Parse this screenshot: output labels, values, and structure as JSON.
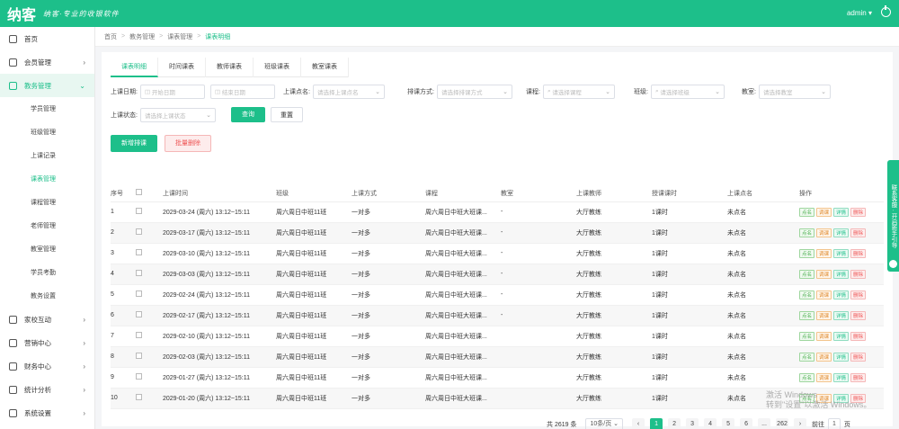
{
  "header": {
    "logo": "纳客",
    "slogan": "纳客·专业的收银软件",
    "user": "admin"
  },
  "sidebar": {
    "items": [
      {
        "label": "首页",
        "icon": "home-icon",
        "expandable": false
      },
      {
        "label": "会员管理",
        "icon": "member-icon",
        "expandable": true
      },
      {
        "label": "教务管理",
        "icon": "teaching-icon",
        "expandable": true,
        "active": true
      }
    ],
    "sub_items": [
      {
        "label": "学员管理"
      },
      {
        "label": "班级管理"
      },
      {
        "label": "上课记录"
      },
      {
        "label": "课表管理",
        "active": true
      },
      {
        "label": "课程管理"
      },
      {
        "label": "老师管理"
      },
      {
        "label": "教室管理"
      },
      {
        "label": "学员考勤"
      },
      {
        "label": "教务设置"
      }
    ],
    "items_bottom": [
      {
        "label": "家校互动",
        "icon": "interaction-icon"
      },
      {
        "label": "营销中心",
        "icon": "marketing-icon"
      },
      {
        "label": "财务中心",
        "icon": "finance-icon"
      },
      {
        "label": "统计分析",
        "icon": "stats-icon"
      },
      {
        "label": "系统设置",
        "icon": "settings-icon"
      }
    ]
  },
  "breadcrumb": [
    "首页",
    "教务管理",
    "课表管理",
    "课表明细"
  ],
  "tabs": [
    {
      "label": "课表明细",
      "active": true
    },
    {
      "label": "时间课表"
    },
    {
      "label": "教师课表"
    },
    {
      "label": "班级课表"
    },
    {
      "label": "教室课表"
    }
  ],
  "filters": {
    "date_label": "上课日期:",
    "date_start_placeholder": "开始日期",
    "date_end_placeholder": "结束日期",
    "sign_label": "上课点名:",
    "sign_placeholder": "请选择上课点名",
    "mode_label": "排课方式:",
    "mode_placeholder": "请选择排课方式",
    "course_label": "课程:",
    "course_placeholder": "请选择课程",
    "class_label": "班级:",
    "class_placeholder": "请选择班级",
    "teacher_label": "教室:",
    "teacher_placeholder": "请选择教室",
    "status_label": "上课状态:",
    "status_placeholder": "请选择上课状态",
    "search_btn": "查询",
    "reset_btn": "重置"
  },
  "actions": {
    "add_btn": "新增排课",
    "batch_delete_btn": "批量删除"
  },
  "table": {
    "headers": [
      "序号",
      "",
      "上课时间",
      "班级",
      "上课方式",
      "课程",
      "教室",
      "上课教师",
      "授课课时",
      "上课点名",
      "操作"
    ],
    "rows": [
      [
        "1",
        "",
        "2029-03-24 (周六) 13:12~15:11",
        "周六周日中班11班",
        "一对多",
        "周六周日中班大班课...",
        "-",
        "大厅教练",
        "1课时",
        "未点名"
      ],
      [
        "2",
        "",
        "2029-03-17 (周六) 13:12~15:11",
        "周六周日中班11班",
        "一对多",
        "周六周日中班大班课...",
        "-",
        "大厅教练",
        "1课时",
        "未点名"
      ],
      [
        "3",
        "",
        "2029-03-10 (周六) 13:12~15:11",
        "周六周日中班11班",
        "一对多",
        "周六周日中班大班课...",
        "-",
        "大厅教练",
        "1课时",
        "未点名"
      ],
      [
        "4",
        "",
        "2029-03-03 (周六) 13:12~15:11",
        "周六周日中班11班",
        "一对多",
        "周六周日中班大班课...",
        "-",
        "大厅教练",
        "1课时",
        "未点名"
      ],
      [
        "5",
        "",
        "2029-02-24 (周六) 13:12~15:11",
        "周六周日中班11班",
        "一对多",
        "周六周日中班大班课...",
        "-",
        "大厅教练",
        "1课时",
        "未点名"
      ],
      [
        "6",
        "",
        "2029-02-17 (周六) 13:12~15:11",
        "周六周日中班11班",
        "一对多",
        "周六周日中班大班课...",
        "-",
        "大厅教练",
        "1课时",
        "未点名"
      ],
      [
        "7",
        "",
        "2029-02-10 (周六) 13:12~15:11",
        "周六周日中班11班",
        "一对多",
        "周六周日中班大班课...",
        "",
        "大厅教练",
        "1课时",
        "未点名"
      ],
      [
        "8",
        "",
        "2029-02-03 (周六) 13:12~15:11",
        "周六周日中班11班",
        "一对多",
        "周六周日中班大班课...",
        "",
        "大厅教练",
        "1课时",
        "未点名"
      ],
      [
        "9",
        "",
        "2029-01-27 (周六) 13:12~15:11",
        "周六周日中班11班",
        "一对多",
        "周六周日中班大班课...",
        "",
        "大厅教练",
        "1课时",
        "未点名"
      ],
      [
        "10",
        "",
        "2029-01-20 (周六) 13:12~15:11",
        "周六周日中班11班",
        "一对多",
        "周六周日中班大班课...",
        "",
        "大厅教练",
        "1课时",
        "未点名"
      ]
    ],
    "ops": [
      "点名",
      "调课",
      "详情",
      "删除"
    ]
  },
  "pagination": {
    "total": "共 2619 条",
    "page_size": "10条/页",
    "pages": [
      "1",
      "2",
      "3",
      "4",
      "5",
      "6",
      "...",
      "262"
    ],
    "goto_label": "前往",
    "goto_value": "1",
    "page_unit": "页"
  },
  "float_bar": {
    "label": "联系客服 · 开启新手引导"
  },
  "watermark": {
    "line1": "激活 Windows",
    "line2": "转到\"设置\"以激活 Windows。"
  }
}
